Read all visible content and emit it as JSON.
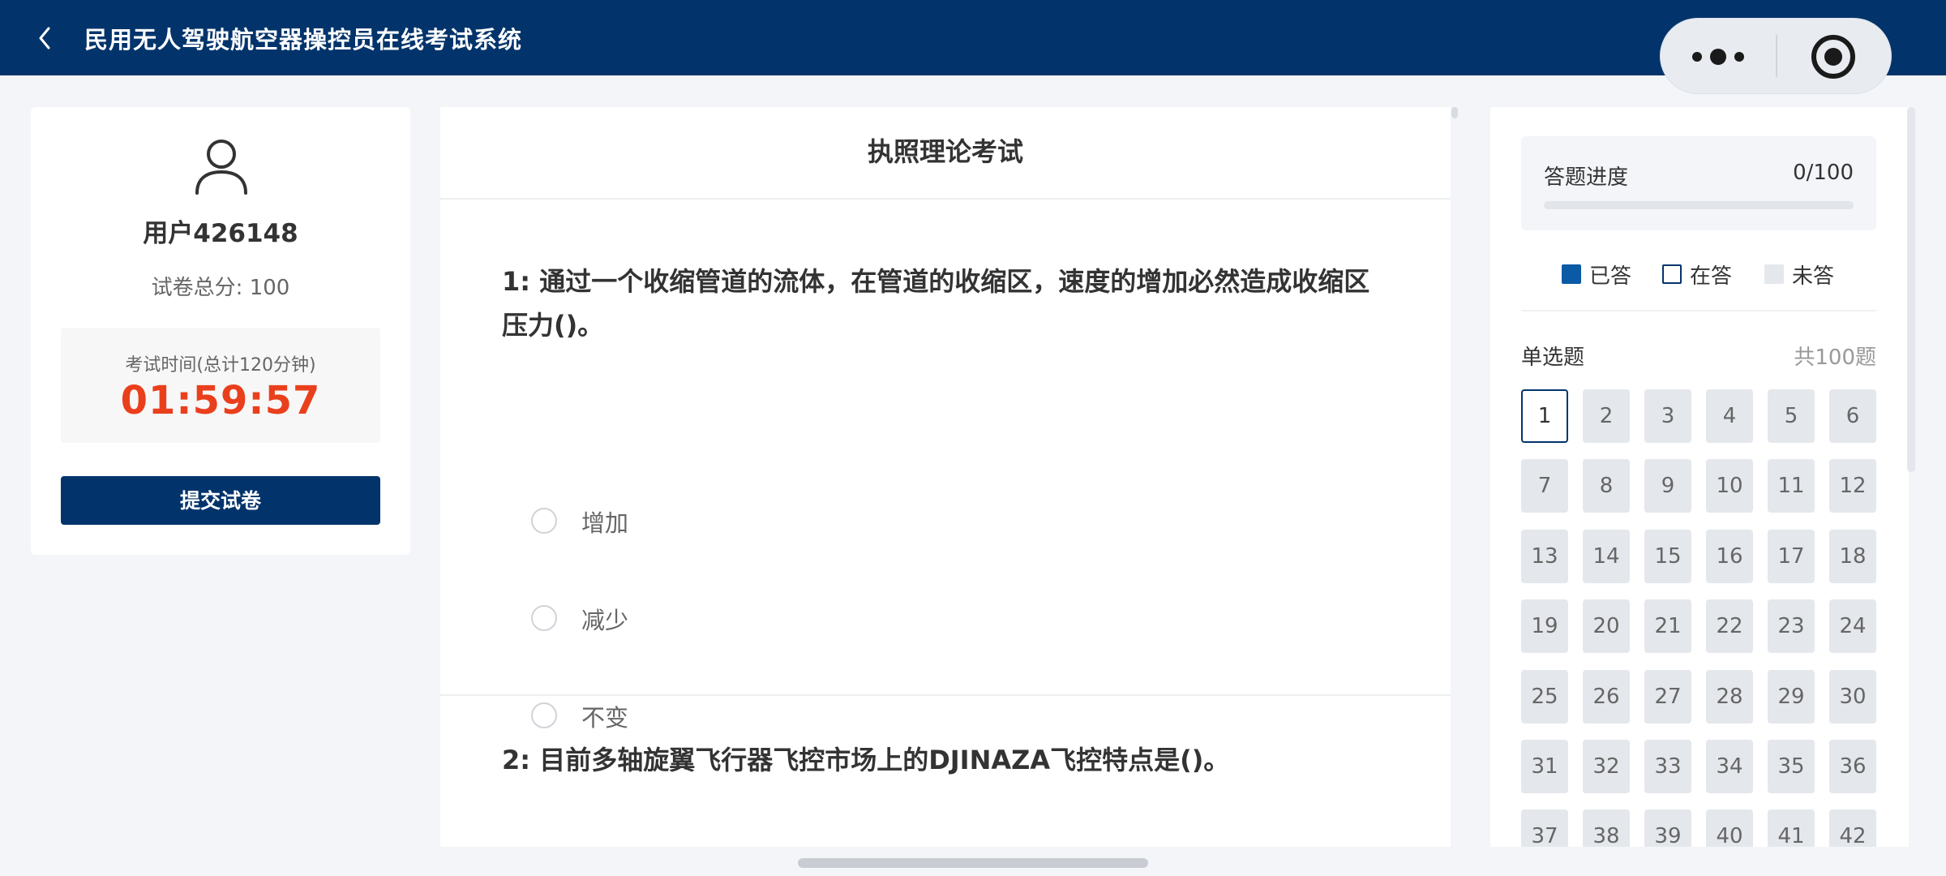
{
  "header": {
    "title": "民用无人驾驶航空器操控员在线考试系统",
    "back_icon": "chevron-left-icon",
    "more_icon": "more-dots-icon",
    "close_icon": "target-circle-icon"
  },
  "user_card": {
    "avatar_icon": "user-outline-icon",
    "username": "用户426148",
    "total_score": "试卷总分: 100",
    "timer_label": "考试时间(总计120分钟)",
    "timer_value": "01:59:57",
    "submit_label": "提交试卷"
  },
  "exam": {
    "title": "执照理论考试",
    "questions": [
      {
        "stem": "1: 通过一个收缩管道的流体，在管道的收缩区，速度的增加必然造成收缩区压力()。",
        "options": [
          "增加",
          "减少",
          "不变"
        ]
      },
      {
        "stem": "2: 目前多轴旋翼飞行器飞控市场上的DJINAZA飞控特点是()。",
        "options": []
      }
    ]
  },
  "progress": {
    "label": "答题进度",
    "count": "0/100",
    "fraction": 0
  },
  "legend": {
    "answered": "已答",
    "current": "在答",
    "unanswered": "未答"
  },
  "section": {
    "title": "单选题",
    "count": "共100题",
    "current_question": 1,
    "visible_numbers": [
      "1",
      "2",
      "3",
      "4",
      "5",
      "6",
      "7",
      "8",
      "9",
      "10",
      "11",
      "12",
      "13",
      "14",
      "15",
      "16",
      "17",
      "18",
      "19",
      "20",
      "21",
      "22",
      "23",
      "24",
      "25",
      "26",
      "27",
      "28",
      "29",
      "30",
      "31",
      "32",
      "33",
      "34",
      "35",
      "36",
      "37",
      "38",
      "39",
      "40",
      "41",
      "42"
    ]
  },
  "colors": {
    "brand": "#02346b",
    "timer": "#ea3f1c",
    "answered": "#0a5aa6"
  }
}
